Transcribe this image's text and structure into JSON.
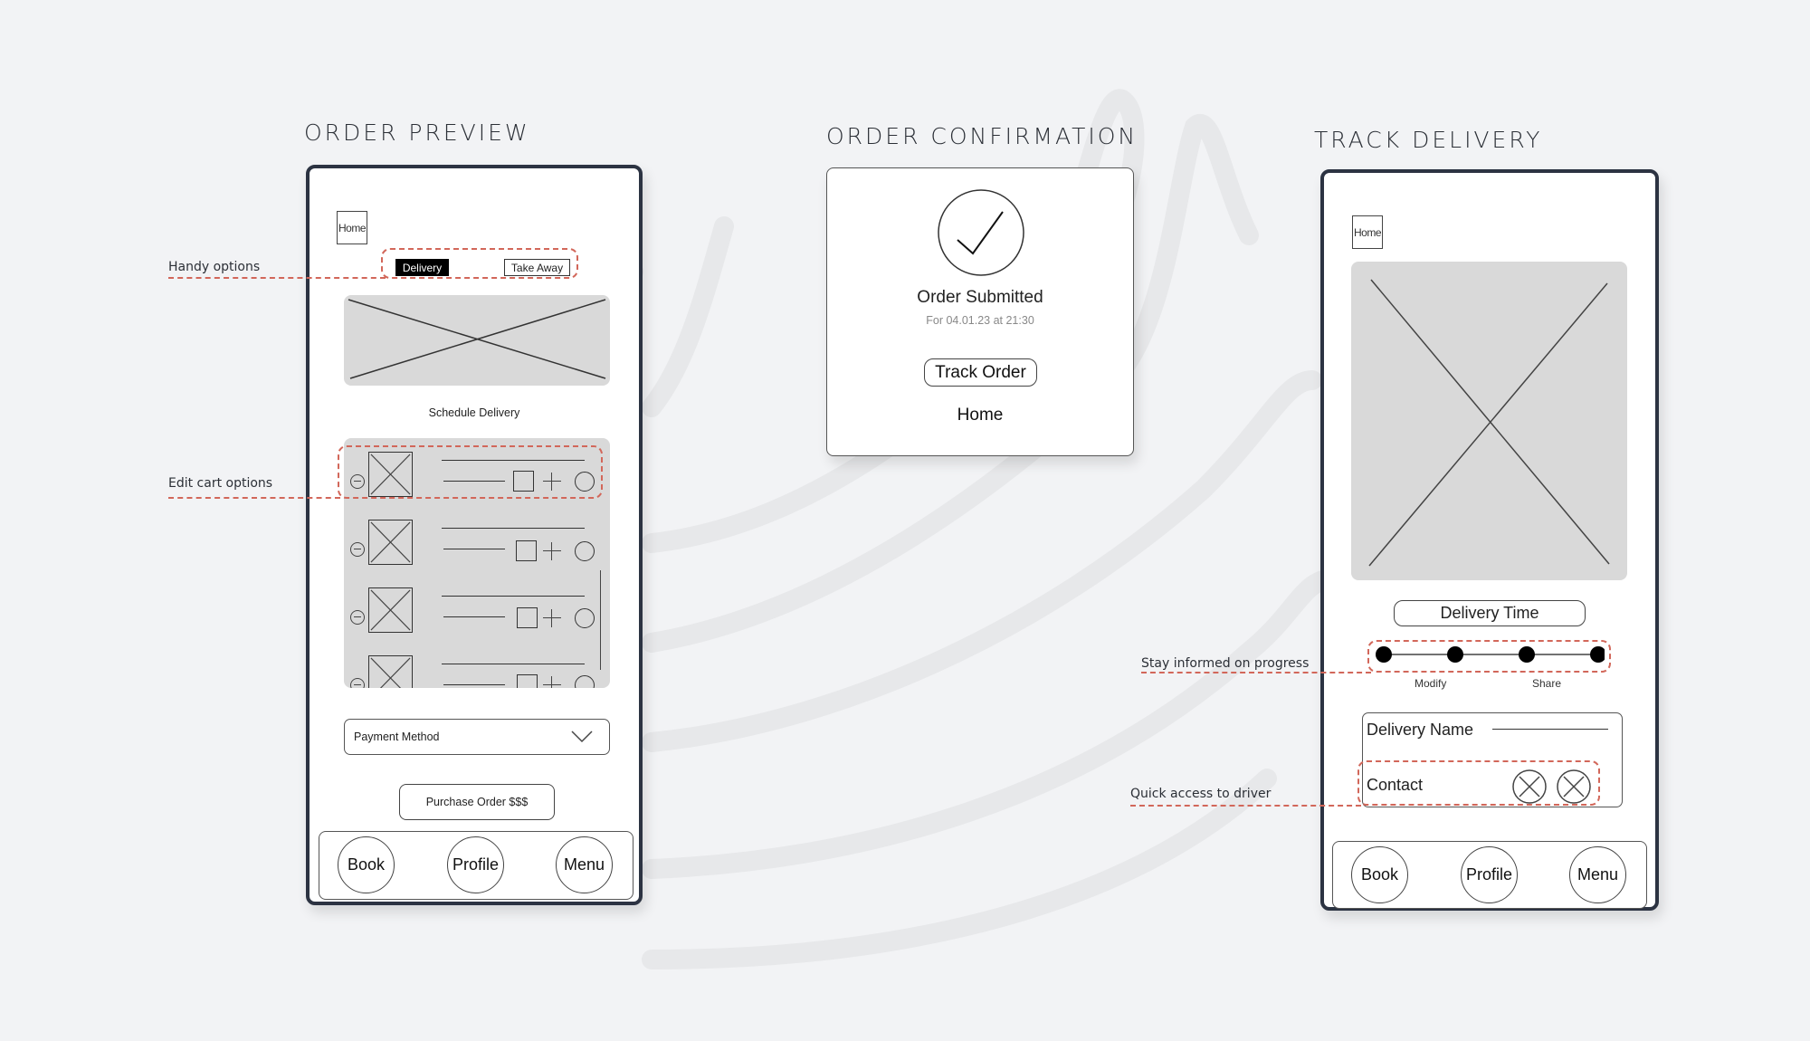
{
  "sections": {
    "order_preview": {
      "title": "ORDER PREVIEW",
      "home_label": "Home",
      "order_type_options": [
        {
          "label": "Delivery",
          "selected": true
        },
        {
          "label": "Take Away",
          "selected": false
        }
      ],
      "image_placeholder": "image-placeholder",
      "schedule_label": "Schedule Delivery",
      "cart_items": [
        {
          "thumbnail": "image-placeholder"
        },
        {
          "thumbnail": "image-placeholder"
        },
        {
          "thumbnail": "image-placeholder"
        },
        {
          "thumbnail": "image-placeholder"
        }
      ],
      "payment_select": {
        "value": "Payment Method",
        "icon": "chevron-down-icon"
      },
      "purchase_button": "Purchase Order $$$",
      "nav": [
        "Book",
        "Profile",
        "Menu"
      ]
    },
    "order_confirmation": {
      "title": "ORDER CONFIRMATION",
      "icon": "checkmark-icon",
      "heading": "Order Submitted",
      "subtext": "For 04.01.23 at 21:30",
      "track_button": "Track Order",
      "home_link": "Home"
    },
    "track_delivery": {
      "title": "TRACK DELIVERY",
      "home_label": "Home",
      "map_placeholder": "image-placeholder",
      "delivery_time_button": "Delivery Time",
      "progress": {
        "steps_total": 4,
        "steps_completed": 4
      },
      "progress_labels": [
        "Modify",
        "Share"
      ],
      "delivery_name_label": "Delivery Name",
      "contact_label": "Contact",
      "contact_icons": [
        "call-icon",
        "message-icon"
      ],
      "nav": [
        "Book",
        "Profile",
        "Menu"
      ]
    }
  },
  "annotations": {
    "handy_options": "Handy options",
    "edit_cart": "Edit cart options",
    "stay_informed": "Stay informed on progress",
    "quick_access": "Quick access to driver"
  },
  "colors": {
    "background": "#f2f3f5",
    "phone_frame": "#2c3342",
    "annotation_dash": "#d2675a",
    "placeholder": "#d9d9d9"
  }
}
